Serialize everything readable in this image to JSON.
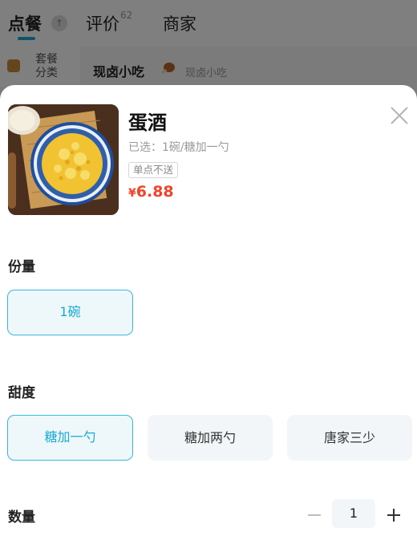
{
  "background": {
    "tabs": [
      {
        "label": "点餐"
      },
      {
        "label": "评价",
        "count": "62"
      },
      {
        "label": "商家"
      }
    ],
    "sidebar": {
      "items": [
        {
          "label": "套餐分类"
        }
      ]
    },
    "section": {
      "title": "现卤小吃",
      "subtitle": "现卤小吃"
    }
  },
  "product": {
    "name": "蛋酒",
    "selected": "已选：1碗/糖加一勺",
    "tag": "单点不送",
    "price_currency": "¥",
    "price_value": "6.88"
  },
  "options": {
    "portion": {
      "title": "份量",
      "items": [
        {
          "label": "1碗",
          "selected": true
        }
      ]
    },
    "sweetness": {
      "title": "甜度",
      "items": [
        {
          "label": "糖加一勺",
          "selected": true
        },
        {
          "label": "糖加两勺",
          "selected": false
        },
        {
          "label": "唐家三少",
          "selected": false
        }
      ]
    }
  },
  "quantity": {
    "title": "数量",
    "value": "1"
  },
  "colors": {
    "accent": "#19a9d6",
    "price": "#f2442b"
  }
}
